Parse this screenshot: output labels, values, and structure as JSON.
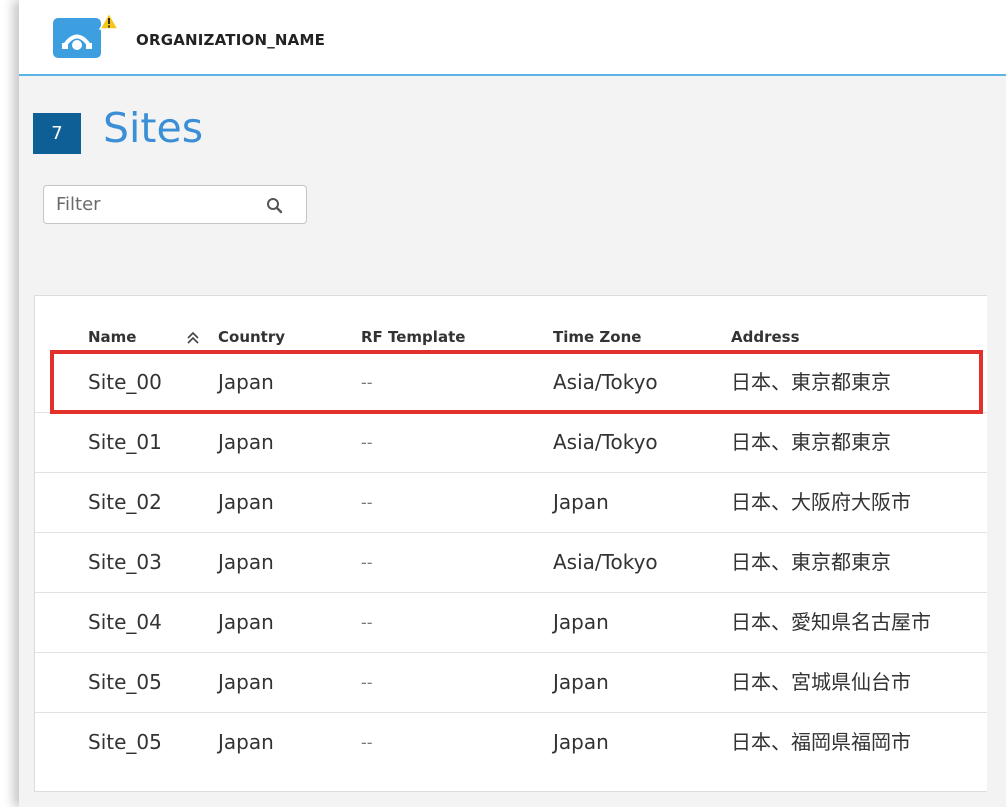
{
  "header": {
    "org_name": "ORGANIZATION_NAME",
    "logo_icon": "network-logo-icon",
    "warning_icon": "warning-icon"
  },
  "page": {
    "count": "7",
    "title": "Sites"
  },
  "filter": {
    "placeholder": "Filter",
    "value": "",
    "icon": "search-icon"
  },
  "table": {
    "columns": [
      "Name",
      "Country",
      "RF Template",
      "Time Zone",
      "Address"
    ],
    "sort": {
      "column": "Name",
      "direction": "ascending",
      "icon": "sort-up-icon"
    },
    "rows": [
      {
        "name": "Site_00",
        "country": "Japan",
        "rf_template": "--",
        "time_zone": "Asia/Tokyo",
        "address": "日本、東京都東京"
      },
      {
        "name": "Site_01",
        "country": "Japan",
        "rf_template": "--",
        "time_zone": "Asia/Tokyo",
        "address": "日本、東京都東京"
      },
      {
        "name": "Site_02",
        "country": "Japan",
        "rf_template": "--",
        "time_zone": "Japan",
        "address": "日本、大阪府大阪市"
      },
      {
        "name": "Site_03",
        "country": "Japan",
        "rf_template": "--",
        "time_zone": "Asia/Tokyo",
        "address": "日本、東京都東京"
      },
      {
        "name": "Site_04",
        "country": "Japan",
        "rf_template": "--",
        "time_zone": "Japan",
        "address": "日本、愛知県名古屋市"
      },
      {
        "name": "Site_05",
        "country": "Japan",
        "rf_template": "--",
        "time_zone": "Japan",
        "address": "日本、宮城県仙台市"
      },
      {
        "name": "Site_05",
        "country": "Japan",
        "rf_template": "--",
        "time_zone": "Japan",
        "address": "日本、福岡県福岡市"
      }
    ]
  },
  "colors": {
    "accent": "#3a8fd6",
    "badge": "#0f5f97",
    "highlight": "#e2312b",
    "logo": "#3d9ee0",
    "warning": "#f5c518"
  }
}
